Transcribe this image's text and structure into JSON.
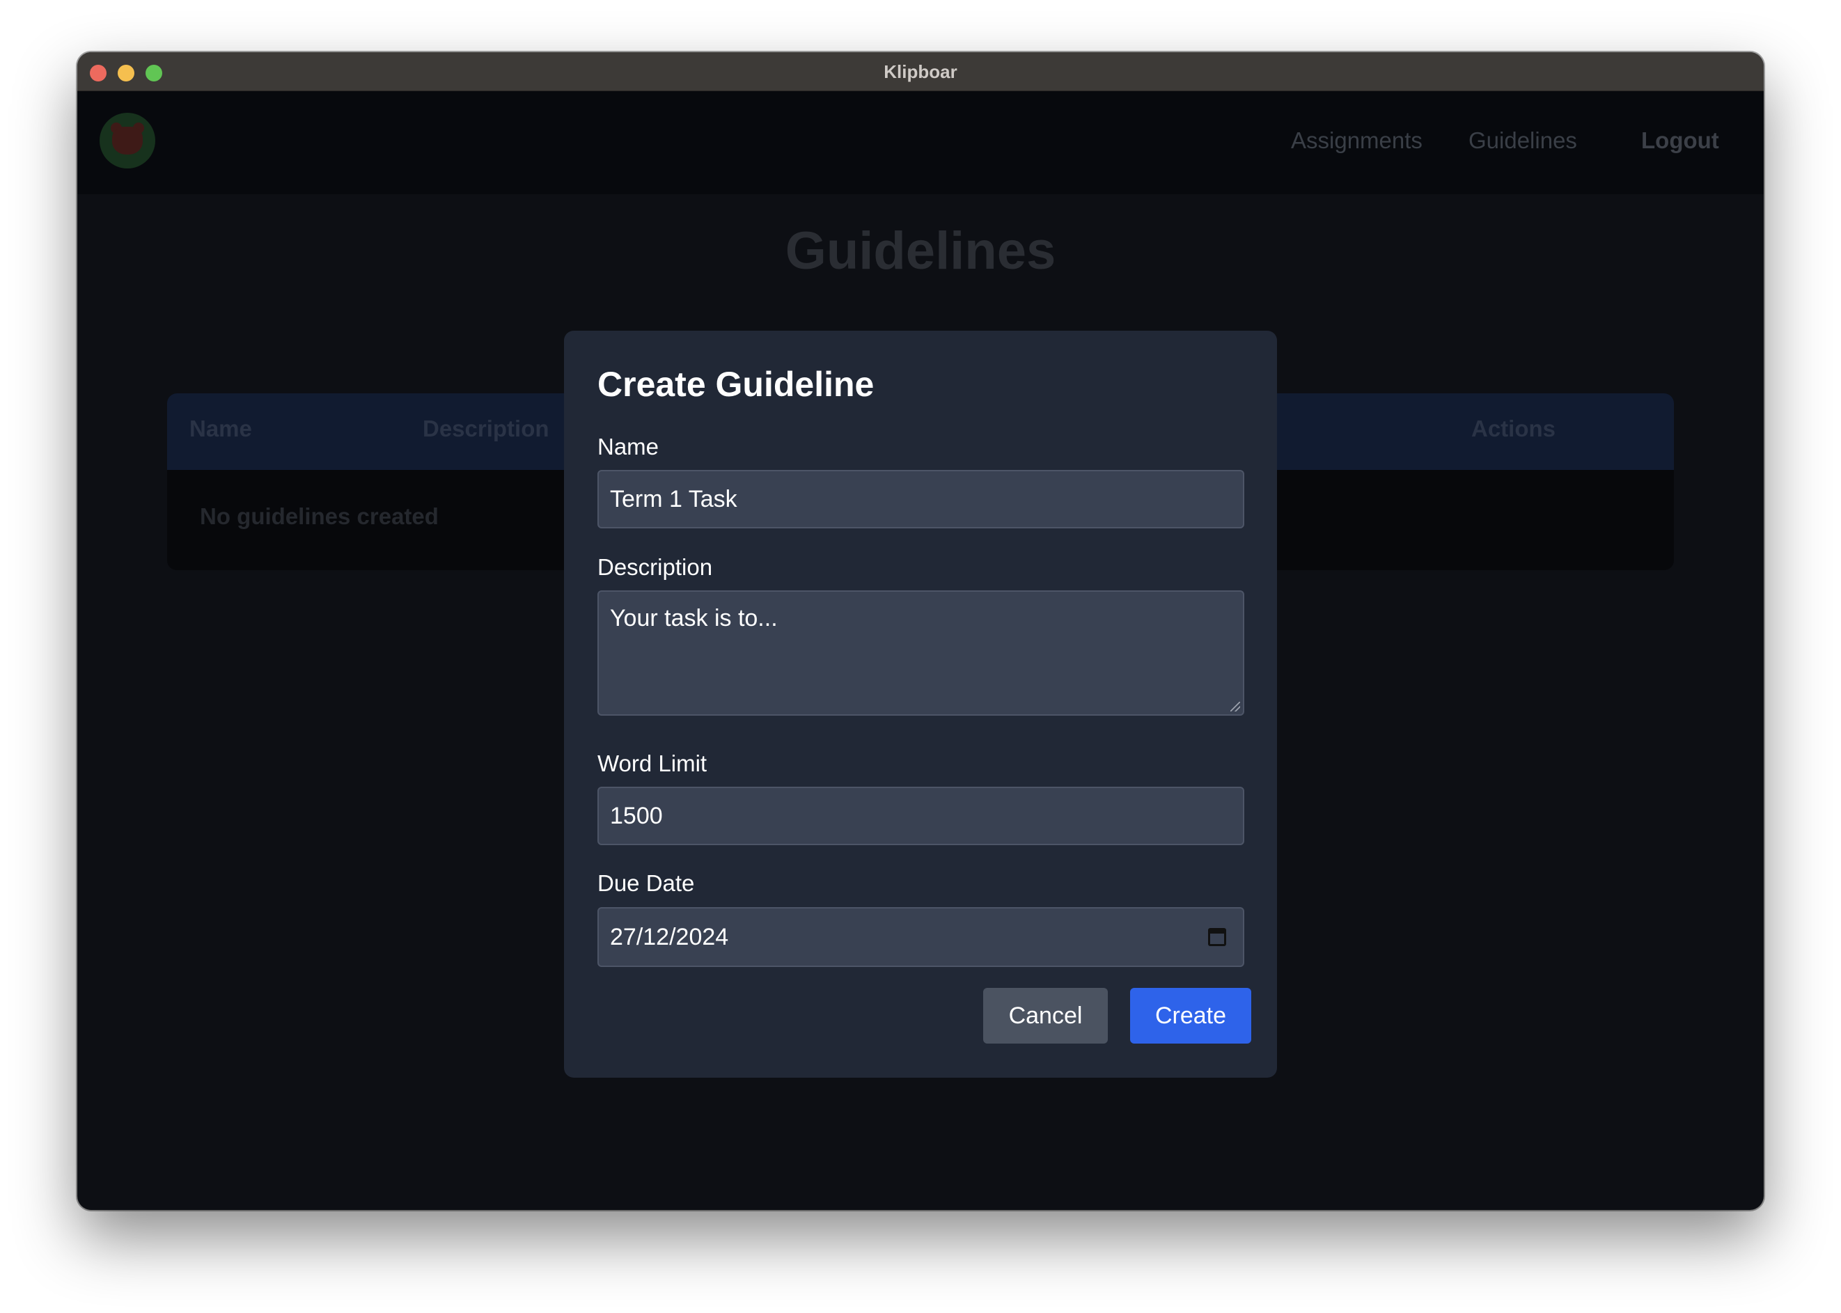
{
  "window": {
    "title": "Klipboar"
  },
  "nav": {
    "links": [
      "Assignments",
      "Guidelines"
    ],
    "logout": "Logout"
  },
  "page": {
    "title": "Guidelines"
  },
  "table": {
    "headers": {
      "name": "Name",
      "description": "Description",
      "actions": "Actions"
    },
    "empty_message": "No guidelines created"
  },
  "modal": {
    "title": "Create Guideline",
    "name_label": "Name",
    "name_value": "Term 1 Task",
    "description_label": "Description",
    "description_value": "Your task is to...",
    "word_limit_label": "Word Limit",
    "word_limit_value": "1500",
    "due_date_label": "Due Date",
    "due_date_value": "27/12/2024",
    "cancel_label": "Cancel",
    "create_label": "Create"
  },
  "colors": {
    "primary_button": "#2e63ea",
    "secondary_button": "#4b5361",
    "modal_background": "#212836",
    "overlay_background": "#0d0f14"
  },
  "icons": [
    "close-icon",
    "minimize-icon",
    "zoom-icon",
    "logo-icon",
    "calendar-icon"
  ]
}
